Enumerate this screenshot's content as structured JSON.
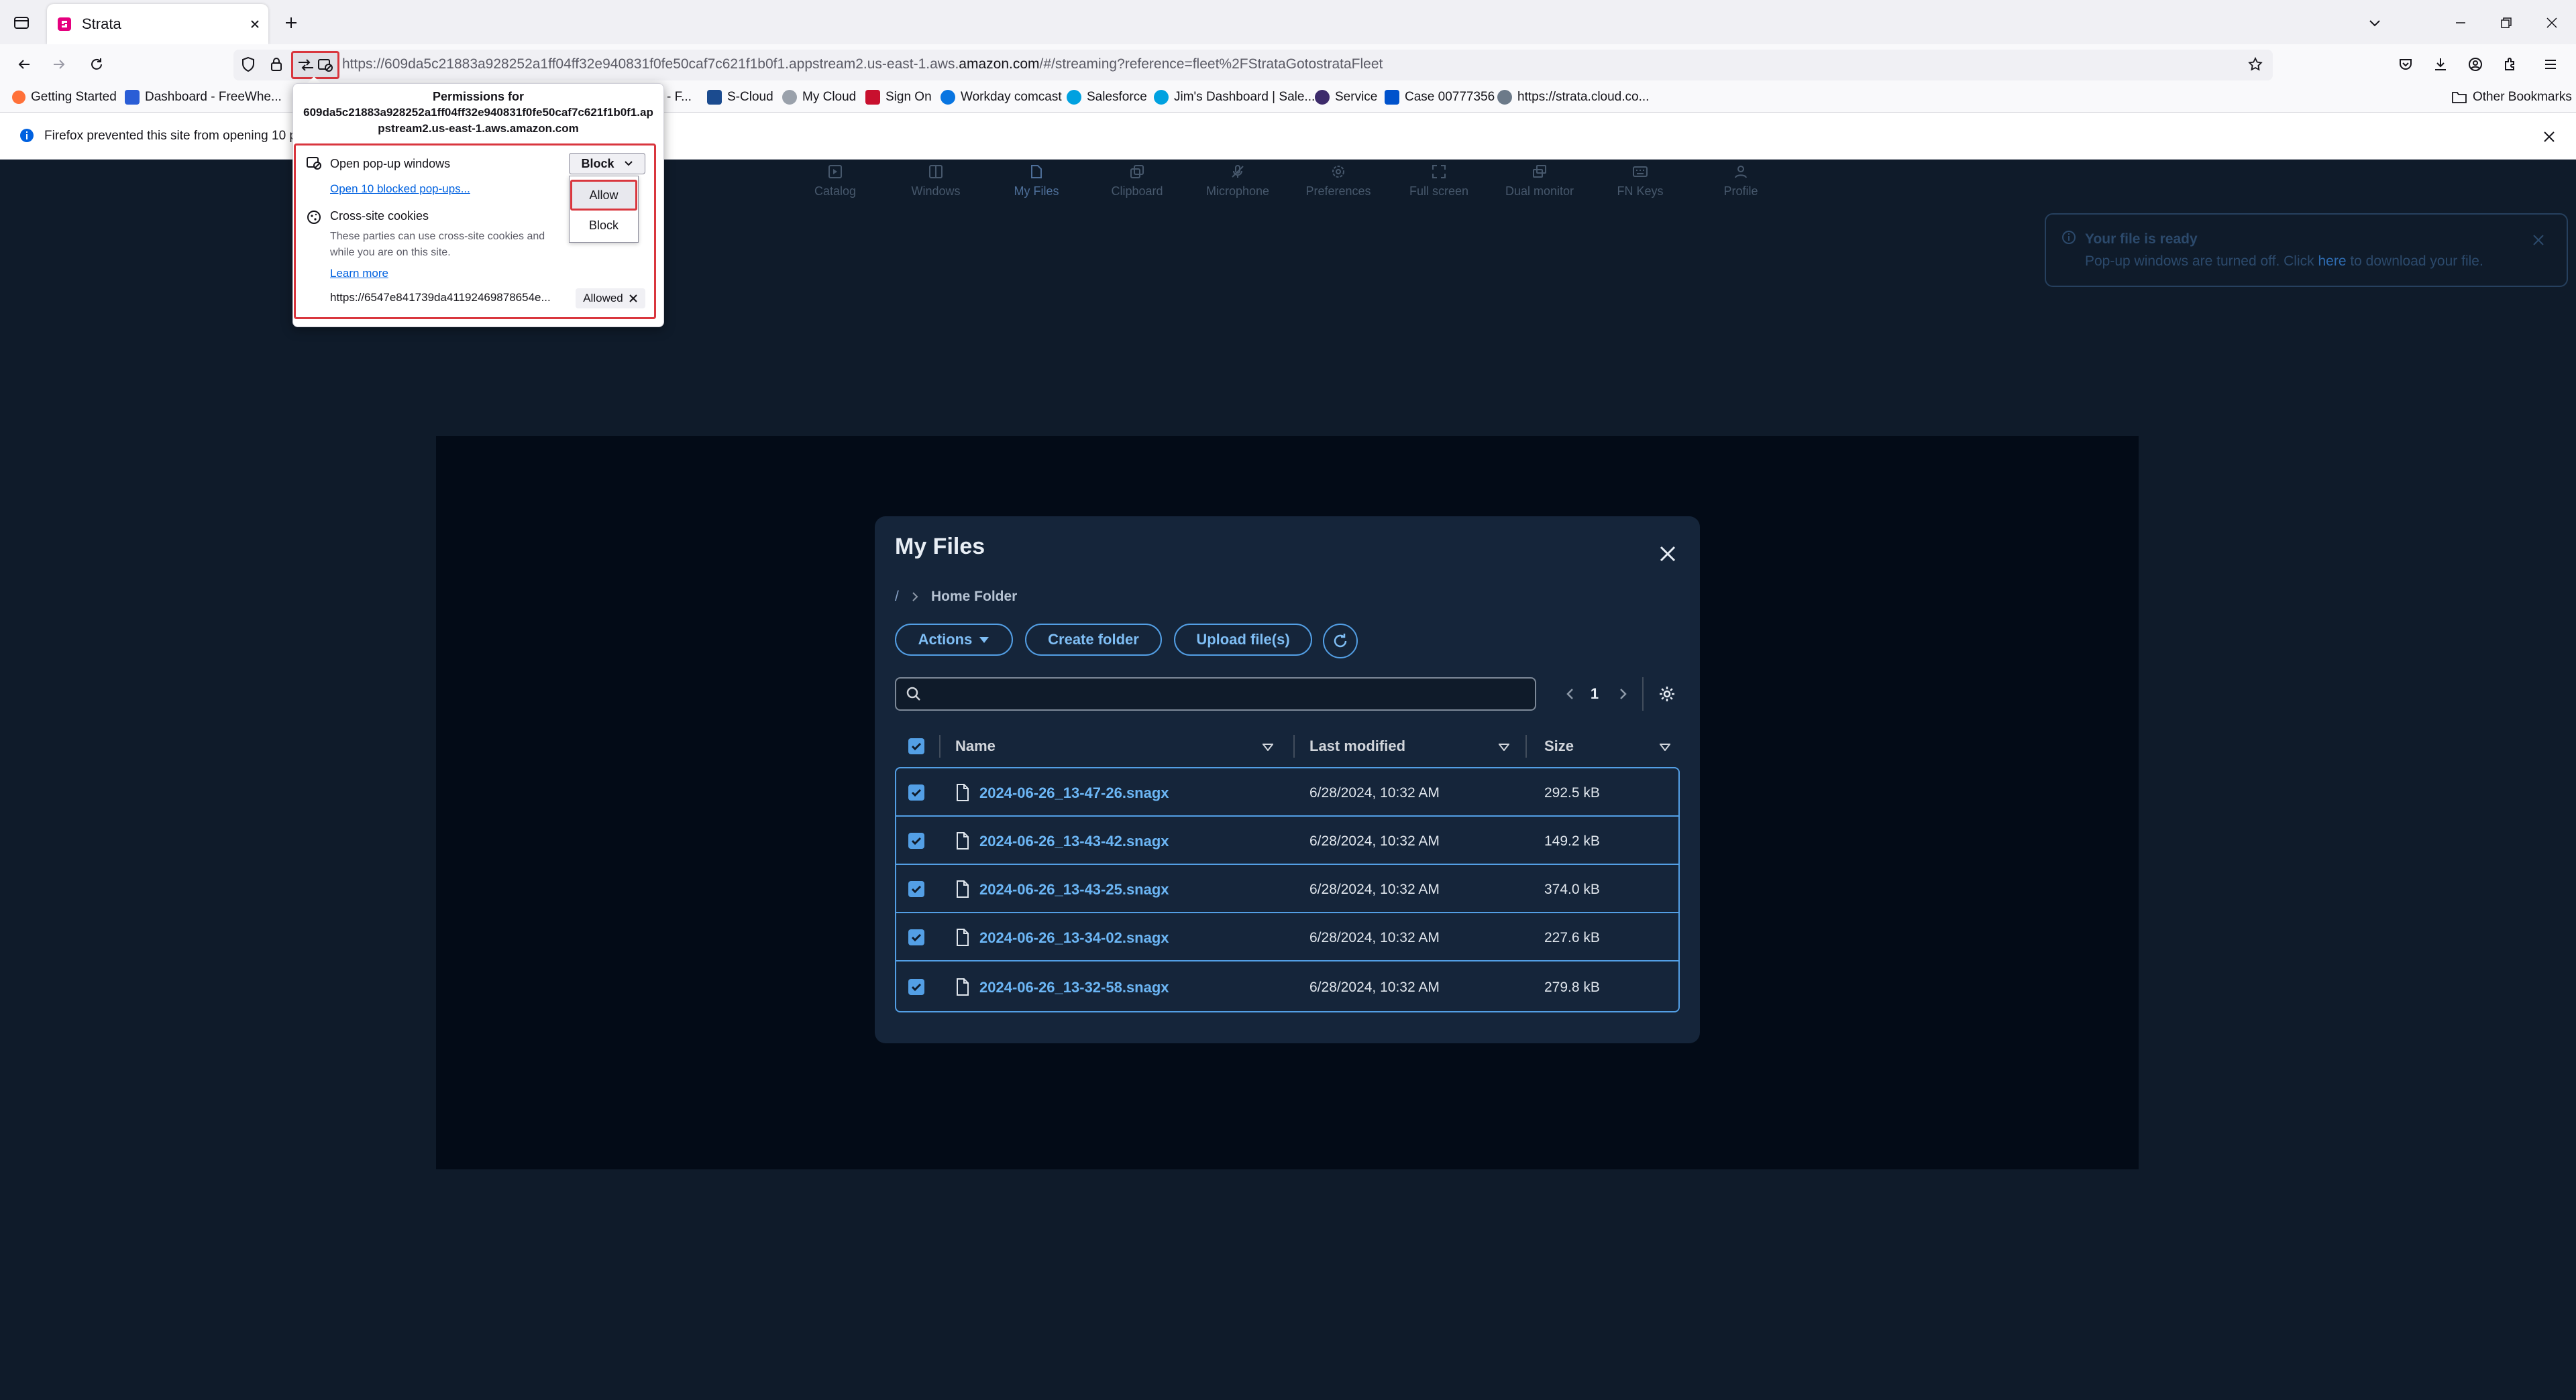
{
  "browser": {
    "tab_title": "Strata",
    "url_prefix": "https://609da5c21883a928252a1ff04ff32e940831f0fe50caf7c621f1b0f1.appstream2.us-east-1.aws.",
    "url_host": "amazon.com",
    "url_suffix": "/#/streaming?reference=fleet%2FStrataGotostrataFleet",
    "bookmarks": [
      "Getting Started",
      "Dashboard - FreeWhe...",
      "- F...",
      "S-Cloud",
      "My Cloud",
      "Sign On",
      "Workday comcast",
      "Salesforce",
      "Jim's Dashboard | Sale...",
      "Service",
      "Case 00777356",
      "https://strata.cloud.co...",
      "Other Bookmarks"
    ],
    "notification": "Firefox prevented this site from opening 10 pc"
  },
  "permissions_popup": {
    "title_line1": "Permissions for",
    "title_line2": "609da5c21883a928252a1ff04ff32e940831f0fe50caf7c621f1b0f1.ap",
    "title_line3": "pstream2.us-east-1.aws.amazon.com",
    "popups_label": "Open pop-up windows",
    "popups_value": "Block",
    "open_blocked_link": "Open 10 blocked pop-ups...",
    "option_allow": "Allow",
    "option_block": "Block",
    "cookies_label": "Cross-site cookies",
    "cookies_desc_1": "These parties can use cross-site cookies and",
    "cookies_desc_2": "while you are on this site.",
    "learn_more": "Learn more",
    "site_entry": "https://6547e841739da41192469878654e...",
    "site_status": "Allowed"
  },
  "toolbar": {
    "items": [
      "Catalog",
      "Windows",
      "My Files",
      "Clipboard",
      "Microphone",
      "Preferences",
      "Full screen",
      "Dual monitor",
      "FN Keys",
      "Profile"
    ],
    "active": "My Files"
  },
  "toast": {
    "title": "Your file is ready",
    "body_pre": "Pop-up windows are turned off. Click ",
    "body_link": "here",
    "body_post": " to download your file."
  },
  "my_files": {
    "title": "My Files",
    "breadcrumb_root": "/",
    "breadcrumb_current": "Home Folder",
    "actions_label": "Actions",
    "create_folder_label": "Create folder",
    "upload_label": "Upload file(s)",
    "search_placeholder": "",
    "page": "1",
    "columns": {
      "name": "Name",
      "modified": "Last modified",
      "size": "Size"
    },
    "rows": [
      {
        "name": "2024-06-26_13-47-26.snagx",
        "modified": "6/28/2024, 10:32 AM",
        "size": "292.5 kB",
        "checked": true
      },
      {
        "name": "2024-06-26_13-43-42.snagx",
        "modified": "6/28/2024, 10:32 AM",
        "size": "149.2 kB",
        "checked": true
      },
      {
        "name": "2024-06-26_13-43-25.snagx",
        "modified": "6/28/2024, 10:32 AM",
        "size": "374.0 kB",
        "checked": true
      },
      {
        "name": "2024-06-26_13-34-02.snagx",
        "modified": "6/28/2024, 10:32 AM",
        "size": "227.6 kB",
        "checked": true
      },
      {
        "name": "2024-06-26_13-32-58.snagx",
        "modified": "6/28/2024, 10:32 AM",
        "size": "279.8 kB",
        "checked": true
      }
    ]
  },
  "colors": {
    "accent": "#539fe5",
    "highlight": "#d9363e",
    "page_bg": "#0f1b2a",
    "modal_bg": "#15253a"
  }
}
